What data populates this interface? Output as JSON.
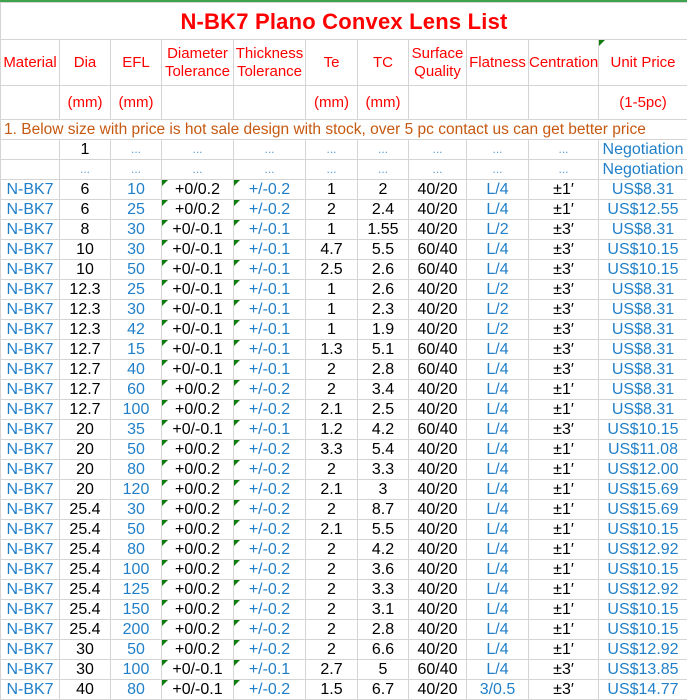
{
  "title": "N-BK7 Plano Convex Lens List",
  "headers": [
    "Material",
    "Dia",
    "EFL",
    "Diameter Tolerance",
    "Thickness Tolerance",
    "Te",
    "TC",
    "Surface Quality",
    "Flatness",
    "Centration",
    "Unit Price"
  ],
  "header_lines": [
    [
      "Material"
    ],
    [
      "Dia"
    ],
    [
      "EFL"
    ],
    [
      "Diameter",
      "Tolerance"
    ],
    [
      "Thickness",
      "Tolerance"
    ],
    [
      "Te"
    ],
    [
      "TC"
    ],
    [
      "Surface",
      "Quality"
    ],
    [
      "Flatness"
    ],
    [
      "Centration"
    ],
    [
      "Unit Price"
    ]
  ],
  "units": [
    "",
    "(mm)",
    "(mm)",
    "",
    "",
    "(mm)",
    "(mm)",
    "",
    "",
    "",
    "(1-5pc)"
  ],
  "note": "1. Below size with price is hot sale design with stock, over 5 pc contact us can get better price",
  "placeholder_rows": [
    [
      "",
      "1",
      "...",
      "...",
      "...",
      "...",
      "...",
      "...",
      "...",
      "...",
      "Negotiation"
    ],
    [
      "",
      "...",
      "...",
      "...",
      "...",
      "...",
      "...",
      "...",
      "...",
      "...",
      "Negotiation"
    ]
  ],
  "rows": [
    [
      "N-BK7",
      "6",
      "10",
      "+0/0.2",
      "+/-0.2",
      "1",
      "2",
      "40/20",
      "L/4",
      "±1′",
      "US$8.31"
    ],
    [
      "N-BK7",
      "6",
      "25",
      "+0/0.2",
      "+/-0.2",
      "2",
      "2.4",
      "40/20",
      "L/4",
      "±1′",
      "US$12.55"
    ],
    [
      "N-BK7",
      "8",
      "30",
      "+0/-0.1",
      "+/-0.1",
      "1",
      "1.55",
      "40/20",
      "L/2",
      "±3′",
      "US$8.31"
    ],
    [
      "N-BK7",
      "10",
      "30",
      "+0/-0.1",
      "+/-0.1",
      "4.7",
      "5.5",
      "60/40",
      "L/4",
      "±3′",
      "US$10.15"
    ],
    [
      "N-BK7",
      "10",
      "50",
      "+0/-0.1",
      "+/-0.1",
      "2.5",
      "2.6",
      "60/40",
      "L/4",
      "±3′",
      "US$10.15"
    ],
    [
      "N-BK7",
      "12.3",
      "25",
      "+0/-0.1",
      "+/-0.1",
      "1",
      "2.6",
      "40/20",
      "L/2",
      "±3′",
      "US$8.31"
    ],
    [
      "N-BK7",
      "12.3",
      "30",
      "+0/-0.1",
      "+/-0.1",
      "1",
      "2.3",
      "40/20",
      "L/2",
      "±3′",
      "US$8.31"
    ],
    [
      "N-BK7",
      "12.3",
      "42",
      "+0/-0.1",
      "+/-0.1",
      "1",
      "1.9",
      "40/20",
      "L/2",
      "±3′",
      "US$8.31"
    ],
    [
      "N-BK7",
      "12.7",
      "15",
      "+0/-0.1",
      "+/-0.1",
      "1.3",
      "5.1",
      "60/40",
      "L/4",
      "±3′",
      "US$8.31"
    ],
    [
      "N-BK7",
      "12.7",
      "40",
      "+0/-0.1",
      "+/-0.1",
      "2",
      "2.8",
      "60/40",
      "L/4",
      "±3′",
      "US$8.31"
    ],
    [
      "N-BK7",
      "12.7",
      "60",
      "+0/0.2",
      "+/-0.2",
      "2",
      "3.4",
      "40/20",
      "L/4",
      "±1′",
      "US$8.31"
    ],
    [
      "N-BK7",
      "12.7",
      "100",
      "+0/0.2",
      "+/-0.2",
      "2.1",
      "2.5",
      "40/20",
      "L/4",
      "±1′",
      "US$8.31"
    ],
    [
      "N-BK7",
      "20",
      "35",
      "+0/-0.1",
      "+/-0.1",
      "1.2",
      "4.2",
      "60/40",
      "L/4",
      "±3′",
      "US$10.15"
    ],
    [
      "N-BK7",
      "20",
      "50",
      "+0/0.2",
      "+/-0.2",
      "3.3",
      "5.4",
      "40/20",
      "L/4",
      "±1′",
      "US$11.08"
    ],
    [
      "N-BK7",
      "20",
      "80",
      "+0/0.2",
      "+/-0.2",
      "2",
      "3.3",
      "40/20",
      "L/4",
      "±1′",
      "US$12.00"
    ],
    [
      "N-BK7",
      "20",
      "120",
      "+0/0.2",
      "+/-0.2",
      "2.1",
      "3",
      "40/20",
      "L/4",
      "±1′",
      "US$15.69"
    ],
    [
      "N-BK7",
      "25.4",
      "30",
      "+0/0.2",
      "+/-0.2",
      "2",
      "8.7",
      "40/20",
      "L/4",
      "±1′",
      "US$15.69"
    ],
    [
      "N-BK7",
      "25.4",
      "50",
      "+0/0.2",
      "+/-0.2",
      "2.1",
      "5.5",
      "40/20",
      "L/4",
      "±1′",
      "US$10.15"
    ],
    [
      "N-BK7",
      "25.4",
      "80",
      "+0/0.2",
      "+/-0.2",
      "2",
      "4.2",
      "40/20",
      "L/4",
      "±1′",
      "US$12.92"
    ],
    [
      "N-BK7",
      "25.4",
      "100",
      "+0/0.2",
      "+/-0.2",
      "2",
      "3.6",
      "40/20",
      "L/4",
      "±1′",
      "US$10.15"
    ],
    [
      "N-BK7",
      "25.4",
      "125",
      "+0/0.2",
      "+/-0.2",
      "2",
      "3.3",
      "40/20",
      "L/4",
      "±1′",
      "US$12.92"
    ],
    [
      "N-BK7",
      "25.4",
      "150",
      "+0/0.2",
      "+/-0.2",
      "2",
      "3.1",
      "40/20",
      "L/4",
      "±1′",
      "US$10.15"
    ],
    [
      "N-BK7",
      "25.4",
      "200",
      "+0/0.2",
      "+/-0.2",
      "2",
      "2.8",
      "40/20",
      "L/4",
      "±1′",
      "US$10.15"
    ],
    [
      "N-BK7",
      "30",
      "50",
      "+0/0.2",
      "+/-0.2",
      "2",
      "6.6",
      "40/20",
      "L/4",
      "±1′",
      "US$12.92"
    ],
    [
      "N-BK7",
      "30",
      "100",
      "+0/-0.1",
      "+/-0.1",
      "2.7",
      "5",
      "60/40",
      "L/4",
      "±3′",
      "US$13.85"
    ],
    [
      "N-BK7",
      "40",
      "80",
      "+0/-0.1",
      "+/-0.2",
      "1.5",
      "6.7",
      "40/20",
      "3/0.5",
      "±3′",
      "US$14.77"
    ]
  ],
  "colors": {
    "title": "#ff0000",
    "header": "#ff0000",
    "note": "#c65911",
    "blue_text": "#1f7fc8",
    "grid": "#d4d4d4",
    "comment_marker": "#107c10",
    "top_border": "#3fa34d"
  }
}
